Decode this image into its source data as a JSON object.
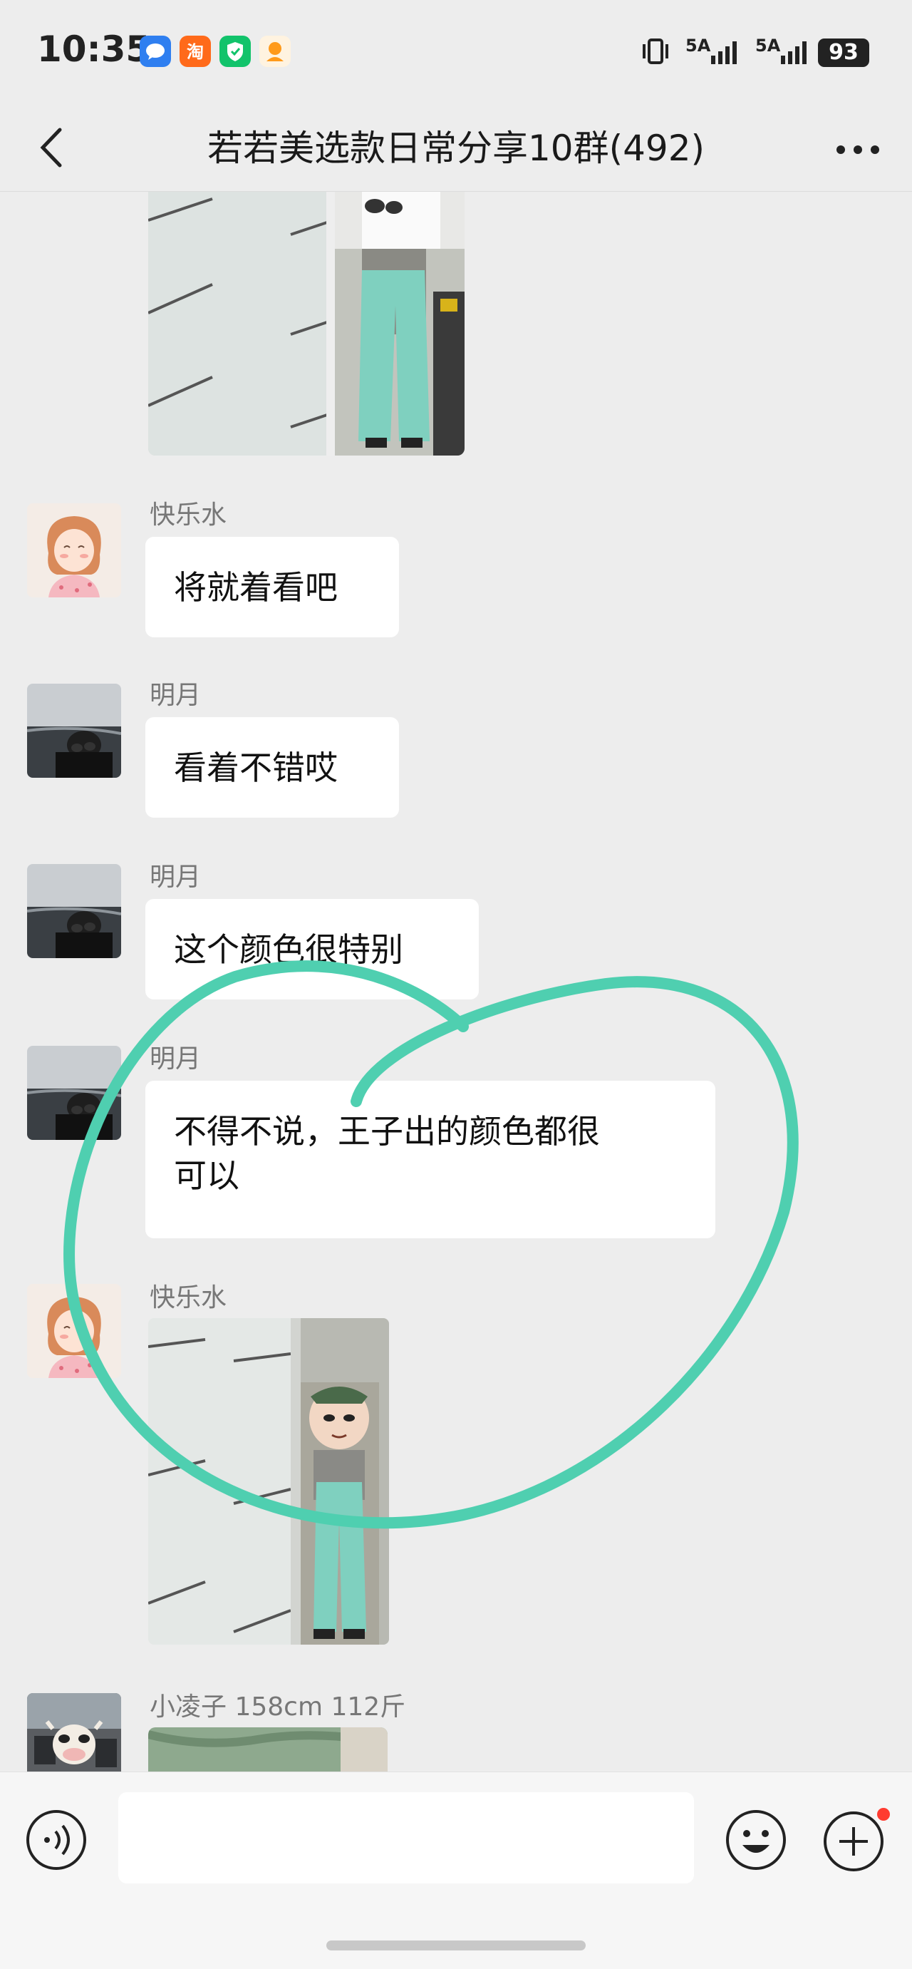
{
  "status_bar": {
    "time": "10:35",
    "network_1": "5A",
    "network_2": "5A",
    "battery": "93"
  },
  "nav": {
    "title": "若若美选款日常分享10群(492)"
  },
  "messages": [
    {
      "type": "image",
      "sender": "",
      "description": "photo-teal-pants-mirror"
    },
    {
      "type": "text",
      "sender": "快乐水",
      "text": "将就着看吧"
    },
    {
      "type": "text",
      "sender": "明月",
      "text": "看着不错哎"
    },
    {
      "type": "text",
      "sender": "明月",
      "text": "这个颜色很特别"
    },
    {
      "type": "text",
      "sender": "明月",
      "text_line1": "不得不说，王子出的颜色都很",
      "text_line2": "可以"
    },
    {
      "type": "image",
      "sender": "快乐水",
      "description": "photo-teal-pants-sticker-face"
    },
    {
      "type": "image",
      "sender": "小凌子 158cm 112斤",
      "description": "photo-green-fabric"
    }
  ],
  "annotation": {
    "color": "#4fcfb0"
  },
  "colors": {
    "background": "#ededed",
    "bubble": "#ffffff",
    "badge": "#ff3b30"
  }
}
